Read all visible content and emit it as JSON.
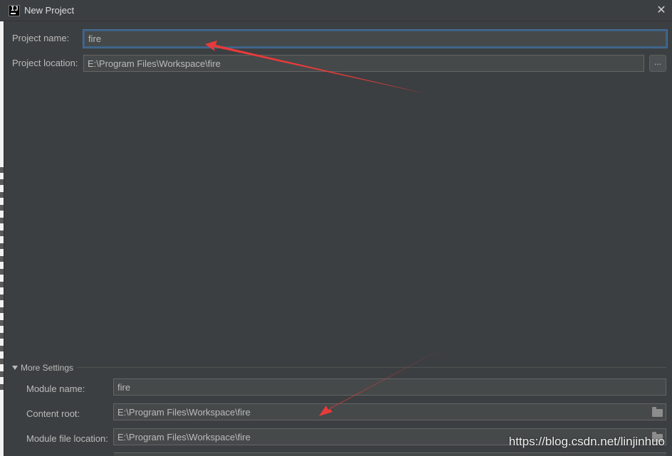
{
  "window": {
    "title": "New Project",
    "icon_text": "IJ",
    "close_symbol": "✕"
  },
  "project": {
    "name_label": "Project name:",
    "name_value": "fire",
    "location_label": "Project location:",
    "location_value": "E:\\Program Files\\Workspace\\fire",
    "browse_label": "..."
  },
  "more_settings": {
    "label": "More Settings",
    "module_name_label": "Module name:",
    "module_name_value": "fire",
    "content_root_label": "Content root:",
    "content_root_value": "E:\\Program Files\\Workspace\\fire",
    "module_file_label": "Module file location:",
    "module_file_value": "E:\\Program Files\\Workspace\\fire"
  },
  "watermark": "https://blog.csdn.net/linjinhuo",
  "icons": {
    "app": "intellij-icon",
    "close": "close-icon",
    "folder": "folder-icon",
    "expand": "triangle-down-icon"
  },
  "colors": {
    "background": "#3c3f41",
    "field_bg": "#45494a",
    "focus_border": "#3d6185",
    "annotation_arrow": "#e83a3a",
    "text": "#bbbbbb"
  }
}
